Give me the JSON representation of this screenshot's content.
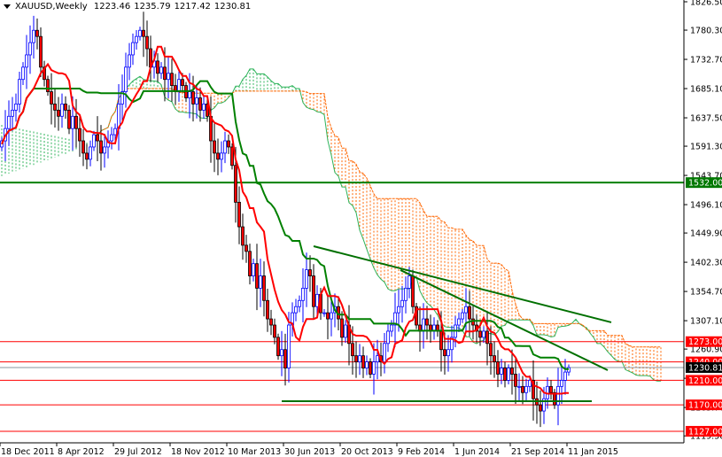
{
  "header": {
    "symbol": "XAUUSD,Weekly",
    "open": "1223.46",
    "high": "1235.79",
    "low": "1217.42",
    "close": "1230.81"
  },
  "colors": {
    "bull": "#0000ff",
    "bear": "#ff0000",
    "tenkan": "#ff0000",
    "kijun": "#008000",
    "cloud_bull": "#2db35a",
    "cloud_bear": "#ff6600",
    "level": "#ff0000",
    "support": "#007000",
    "current": "#8a949c"
  },
  "chart_data": {
    "type": "candlestick",
    "title": "XAUUSD,Weekly",
    "timeframe": "weekly",
    "indicator": "Ichimoku Kinko Hyo (9, 26, 52)",
    "ylim": [
      1115.5,
      1826.5
    ],
    "y_ticks": [
      "1826.50",
      "1780.30",
      "1732.70",
      "1685.10",
      "1637.50",
      "1591.30",
      "1543.70",
      "1496.10",
      "1449.90",
      "1402.30",
      "1354.70",
      "1307.10",
      "1260.90",
      "1213.30",
      "1165.70",
      "1119.50"
    ],
    "x_ticks": [
      {
        "week": 0,
        "label": "18 Dec 2011"
      },
      {
        "week": 16,
        "label": "8 Apr 2012"
      },
      {
        "week": 32,
        "label": "29 Jul 2012"
      },
      {
        "week": 48,
        "label": "18 Nov 2012"
      },
      {
        "week": 64,
        "label": "10 Mar 2013"
      },
      {
        "week": 80,
        "label": "30 Jun 2013"
      },
      {
        "week": 96,
        "label": "20 Oct 2013"
      },
      {
        "week": 112,
        "label": "9 Feb 2014"
      },
      {
        "week": 128,
        "label": "1 Jun 2014"
      },
      {
        "week": 144,
        "label": "21 Sep 2014"
      },
      {
        "week": 160,
        "label": "11 Jan 2015"
      }
    ],
    "weekly_close": [
      1600,
      1620,
      1640,
      1650,
      1660,
      1700,
      1720,
      1740,
      1760,
      1780,
      1770,
      1720,
      1700,
      1680,
      1660,
      1650,
      1640,
      1660,
      1650,
      1620,
      1640,
      1620,
      1600,
      1580,
      1570,
      1590,
      1610,
      1600,
      1580,
      1590,
      1600,
      1610,
      1620,
      1660,
      1680,
      1720,
      1740,
      1760,
      1770,
      1780,
      1770,
      1750,
      1720,
      1730,
      1710,
      1720,
      1700,
      1710,
      1690,
      1680,
      1700,
      1690,
      1670,
      1680,
      1660,
      1670,
      1650,
      1660,
      1640,
      1600,
      1580,
      1570,
      1580,
      1600,
      1590,
      1560,
      1500,
      1460,
      1430,
      1420,
      1380,
      1400,
      1360,
      1380,
      1340,
      1310,
      1300,
      1280,
      1250,
      1260,
      1230,
      1300,
      1320,
      1330,
      1340,
      1360,
      1390,
      1380,
      1330,
      1350,
      1320,
      1320,
      1310,
      1320,
      1330,
      1310,
      1280,
      1300,
      1270,
      1250,
      1240,
      1250,
      1230,
      1240,
      1220,
      1240,
      1250,
      1240,
      1270,
      1290,
      1300,
      1320,
      1330,
      1340,
      1360,
      1380,
      1330,
      1300,
      1290,
      1310,
      1300,
      1290,
      1300,
      1290,
      1260,
      1250,
      1260,
      1280,
      1300,
      1310,
      1320,
      1330,
      1310,
      1300,
      1290,
      1280,
      1290,
      1270,
      1250,
      1240,
      1220,
      1230,
      1210,
      1230,
      1220,
      1200,
      1200,
      1190,
      1200,
      1210,
      1180,
      1170,
      1160,
      1180,
      1200,
      1190,
      1170,
      1200,
      1210,
      1223.46,
      1230.81
    ],
    "horizontal_levels": [
      {
        "price": 1532.0,
        "label": "1532.00",
        "color": "#008000"
      },
      {
        "price": 1273.0,
        "label": "1273.00",
        "color": "#ff0000"
      },
      {
        "price": 1240.0,
        "label": "1240.00",
        "color": "#ff0000"
      },
      {
        "price": 1210.0,
        "label": "1210.00",
        "color": "#ff0000"
      },
      {
        "price": 1170.0,
        "label": "1170.00",
        "color": "#ff0000"
      },
      {
        "price": 1127.0,
        "label": "1127.00",
        "color": "#ff0000"
      }
    ],
    "current_price": {
      "price": 1230.81,
      "label": "1230.81"
    },
    "trendlines": [
      {
        "name": "upper-resistance-trendline",
        "from": [
          88,
          1428.4
        ],
        "to": [
          172,
          1304.4
        ]
      },
      {
        "name": "lower-resistance-trendline",
        "from": [
          112.5,
          1389.5
        ],
        "to": [
          171,
          1226.5
        ]
      },
      {
        "name": "support-line",
        "from": [
          79,
          1176
        ],
        "to": [
          166.5,
          1176
        ]
      }
    ]
  }
}
